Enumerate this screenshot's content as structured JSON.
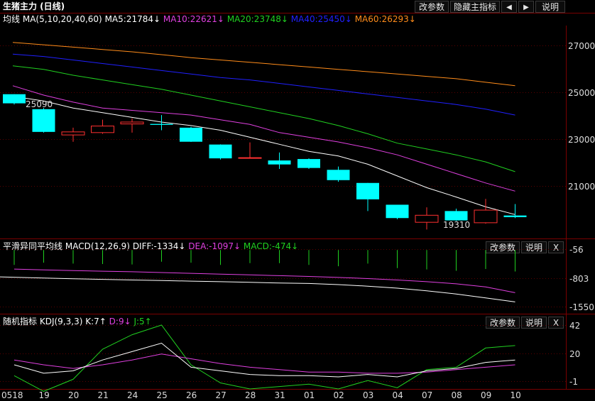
{
  "header": {
    "title": "生猪主力 (日线)",
    "buttons": [
      "改参数",
      "隐藏主指标",
      "◀",
      "▶",
      "说明"
    ]
  },
  "main_panel": {
    "name": "均线",
    "params": "MA(5,10,20,40,60)",
    "indicators": [
      {
        "label": "MA5:21784↓",
        "color": "#ffffff"
      },
      {
        "label": "MA10:22621↓",
        "color": "#e040e0"
      },
      {
        "label": "MA20:23748↓",
        "color": "#20d020"
      },
      {
        "label": "MA40:25450↓",
        "color": "#2020ff"
      },
      {
        "label": "MA60:26293↓",
        "color": "#ff8c1a"
      }
    ],
    "y_ticks": [
      "27000",
      "25000",
      "23000",
      "21000"
    ],
    "annot_high": "25090",
    "annot_low": "19310"
  },
  "macd_panel": {
    "name": "平滑异同平均线",
    "params": "MACD(12,26,9)",
    "indicators": [
      {
        "label": "DIFF:-1334↓",
        "color": "#ffffff"
      },
      {
        "label": "DEA:-1097↓",
        "color": "#e040e0"
      },
      {
        "label": "MACD:-474↓",
        "color": "#20d020"
      }
    ],
    "buttons": [
      "改参数",
      "说明",
      "X"
    ],
    "y_ticks": [
      "-56",
      "-803",
      "-1550"
    ]
  },
  "kdj_panel": {
    "name": "随机指标",
    "params": "KDJ(9,3,3)",
    "indicators": [
      {
        "label": "K:7↑",
        "color": "#ffffff"
      },
      {
        "label": "D:9↓",
        "color": "#e040e0"
      },
      {
        "label": "J:5↑",
        "color": "#20d020"
      }
    ],
    "buttons": [
      "改参数",
      "说明",
      "X"
    ],
    "y_ticks": [
      "42",
      "20",
      "-1"
    ]
  },
  "x_axis": [
    "0518",
    "19",
    "20",
    "21",
    "24",
    "25",
    "26",
    "27",
    "28",
    "31",
    "01",
    "02",
    "03",
    "04",
    "07",
    "08",
    "09",
    "10"
  ],
  "chart_data": {
    "type": "candlestick",
    "dates": [
      "0518",
      "19",
      "20",
      "21",
      "24",
      "25",
      "26",
      "27",
      "28",
      "31",
      "01",
      "02",
      "03",
      "04",
      "07",
      "08",
      "09",
      "10"
    ],
    "candles": [
      {
        "o": 25090,
        "c": 24700,
        "h": 25090,
        "l": 24650
      },
      {
        "o": 24450,
        "c": 23480,
        "h": 24500,
        "l": 23450
      },
      {
        "o": 23350,
        "c": 23480,
        "h": 23660,
        "l": 23060
      },
      {
        "o": 23450,
        "c": 23730,
        "h": 24000,
        "l": 23400
      },
      {
        "o": 23820,
        "c": 23900,
        "h": 24060,
        "l": 23450
      },
      {
        "o": 23820,
        "c": 23780,
        "h": 24200,
        "l": 23550
      },
      {
        "o": 23660,
        "c": 23060,
        "h": 23700,
        "l": 23050
      },
      {
        "o": 22940,
        "c": 22350,
        "h": 22950,
        "l": 22300
      },
      {
        "o": 22380,
        "c": 22380,
        "h": 23030,
        "l": 22350
      },
      {
        "o": 22260,
        "c": 22090,
        "h": 22600,
        "l": 21900
      },
      {
        "o": 22320,
        "c": 21940,
        "h": 22350,
        "l": 21900
      },
      {
        "o": 21860,
        "c": 21420,
        "h": 22000,
        "l": 21350
      },
      {
        "o": 21300,
        "c": 20600,
        "h": 21300,
        "l": 20100
      },
      {
        "o": 20370,
        "c": 19800,
        "h": 20370,
        "l": 19750
      },
      {
        "o": 19620,
        "c": 19920,
        "h": 20260,
        "l": 19310
      },
      {
        "o": 20100,
        "c": 19700,
        "h": 20200,
        "l": 19680
      },
      {
        "o": 19600,
        "c": 20140,
        "h": 20620,
        "l": 19560
      },
      {
        "o": 19910,
        "c": 19840,
        "h": 20400,
        "l": 19800
      }
    ],
    "ma_lines": [
      {
        "name": "MA5",
        "color": "#ffffff",
        "values": [
          25000,
          24800,
          24500,
          24300,
          24100,
          23900,
          23750,
          23550,
          23250,
          22950,
          22650,
          22450,
          22100,
          21600,
          21100,
          20700,
          20280,
          19950
        ]
      },
      {
        "name": "MA10",
        "color": "#e040e0",
        "values": [
          25450,
          25050,
          24750,
          24500,
          24400,
          24300,
          24200,
          24000,
          23800,
          23450,
          23250,
          23050,
          22800,
          22500,
          22100,
          21700,
          21300,
          20950
        ]
      },
      {
        "name": "MA20",
        "color": "#20d020",
        "values": [
          26300,
          26150,
          25900,
          25700,
          25500,
          25300,
          25050,
          24800,
          24550,
          24300,
          24050,
          23750,
          23400,
          23000,
          22750,
          22500,
          22200,
          21780
        ]
      },
      {
        "name": "MA40",
        "color": "#2020ff",
        "values": [
          26800,
          26700,
          26550,
          26400,
          26250,
          26100,
          25950,
          25800,
          25700,
          25550,
          25400,
          25250,
          25100,
          24950,
          24800,
          24650,
          24450,
          24200
        ]
      },
      {
        "name": "MA60",
        "color": "#ff8c1a",
        "values": [
          27300,
          27200,
          27100,
          27000,
          26900,
          26780,
          26650,
          26550,
          26450,
          26350,
          26250,
          26150,
          26050,
          25950,
          25850,
          25750,
          25600,
          25450
        ]
      }
    ],
    "price_ylim": [
      19050,
      27900
    ],
    "macd": {
      "histogram": [
        -330,
        -280,
        -300,
        -310,
        -320,
        -260,
        -280,
        -330,
        -290,
        -290,
        -330,
        -360,
        -300,
        -400,
        -430,
        -460,
        -420,
        -474
      ],
      "diff": [
        -690,
        -720,
        -740,
        -755,
        -770,
        -785,
        -800,
        -815,
        -830,
        -850,
        -860,
        -890,
        -930,
        -980,
        -1050,
        -1130,
        -1230,
        -1334
      ],
      "dea": [
        -490,
        -510,
        -530,
        -545,
        -560,
        -580,
        -600,
        -620,
        -640,
        -660,
        -680,
        -705,
        -735,
        -770,
        -815,
        -870,
        -950,
        -1097
      ],
      "ylim": [
        -1600,
        40
      ]
    },
    "kdj": {
      "k": [
        12,
        5,
        7,
        16,
        23,
        30,
        10,
        7,
        4,
        3,
        3,
        2,
        4,
        2,
        7,
        9,
        14,
        16
      ],
      "d": [
        16,
        12,
        9,
        12,
        16,
        21,
        17,
        13,
        10,
        8,
        6,
        6,
        5,
        5,
        6,
        8,
        10,
        12
      ],
      "j": [
        3,
        -10,
        0,
        25,
        37,
        45,
        12,
        -3,
        -8,
        -6,
        -4,
        -8,
        -1,
        -7,
        8,
        10,
        26,
        28
      ],
      "ylim": [
        -8,
        45
      ]
    }
  }
}
